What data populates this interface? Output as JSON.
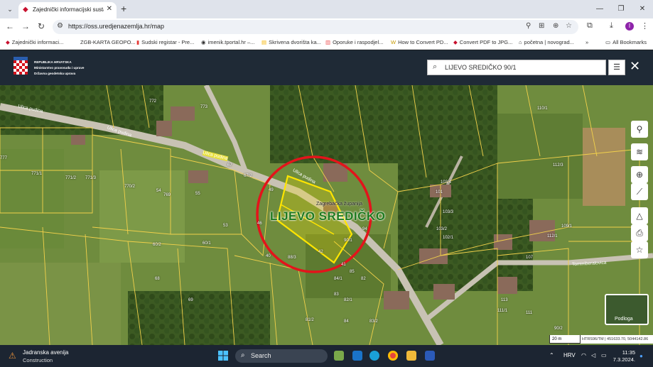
{
  "browser": {
    "tab_title": "Zajednički informacijski sustav z",
    "url": "https://oss.uredjenazemlja.hr/map",
    "bookmarks": [
      "Zajednički informaci...",
      "ZGB-KARTA GEOPO...",
      "Sudski registar - Pre...",
      "imenik.tportal.hr –...",
      "Skrivena dvorišta ka...",
      "Oporuke i raspodjel...",
      "How to Convert PD...",
      "Convert PDF to JPG...",
      "početna | novograd...",
      "All Bookmarks"
    ],
    "profile_initial": "I",
    "overflow": "»"
  },
  "app": {
    "org_lines": [
      "REPUBLIKA HRVATSKA",
      "Ministarstvo pravosuđa i uprave",
      "Državna geodetska uprava"
    ],
    "search_value": "LIJEVO SREDIČKO 90/1"
  },
  "map": {
    "place_label": "LIJEVO SREDIČKO",
    "county_label": "Zagrebačka županija",
    "street_labels": [
      "Ulica pudina",
      "Ulica pudina",
      "Ulica pudina",
      "Ulica pudina",
      "Tominiberalovica"
    ],
    "parcel_labels": [
      "772",
      "773",
      "771/1",
      "771/2",
      "771/3",
      "770/2",
      "769",
      "777",
      "54",
      "67",
      "67/2",
      "60/2",
      "60/1",
      "68",
      "69",
      "49",
      "46",
      "40",
      "42",
      "41",
      "90/1",
      "94",
      "85",
      "82",
      "83",
      "82/1",
      "81/2",
      "84",
      "83/2",
      "84/1",
      "88/3",
      "55",
      "53",
      "102/1",
      "101",
      "103/2",
      "103/3",
      "103/4",
      "110/1",
      "112/3",
      "112/1",
      "109/1",
      "107",
      "111/1",
      "111",
      "113",
      "90/2"
    ],
    "scale": "20 m",
    "coords": "HTRS96/TM | 451633.70, 5044142.86",
    "basemap_label": "Podloga",
    "colors": {
      "parcel_line": "#f2d14b",
      "highlight": "#ffe500",
      "circle": "#e3141b",
      "label_green": "#1f7a1f"
    }
  },
  "taskbar": {
    "weather_title": "Jadranska avenija",
    "weather_sub": "Construction",
    "search_placeholder": "Search",
    "lang": "HRV",
    "time": "11:35",
    "date": "7.3.2024."
  }
}
